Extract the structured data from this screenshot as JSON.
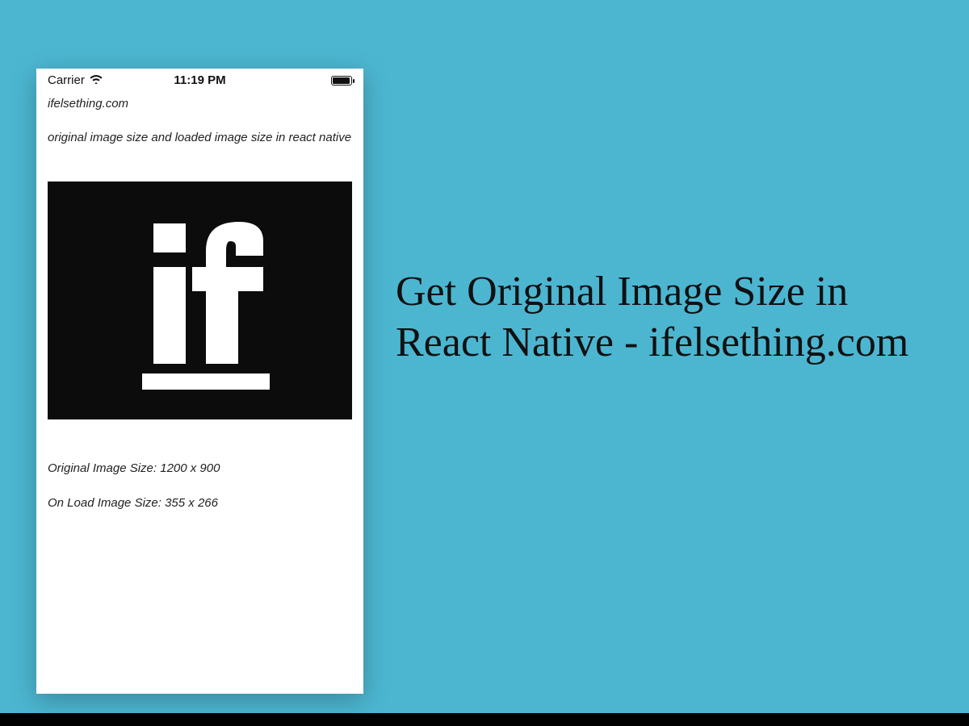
{
  "colors": {
    "background": "#4cb6d1",
    "logo_bg": "#0c0c0c"
  },
  "status": {
    "carrier": "Carrier",
    "wifi_icon": "wifi-icon",
    "time": "11:19 PM",
    "battery_icon": "battery-full-icon"
  },
  "app": {
    "site": "ifelsething.com",
    "subtitle": "original image size and loaded image size in react native",
    "original_size_label": "Original Image Size: 1200 x 900",
    "onload_size_label": "On Load Image Size: 355 x 266"
  },
  "title": "Get Original Image Size in React Native - ifelsething.com"
}
